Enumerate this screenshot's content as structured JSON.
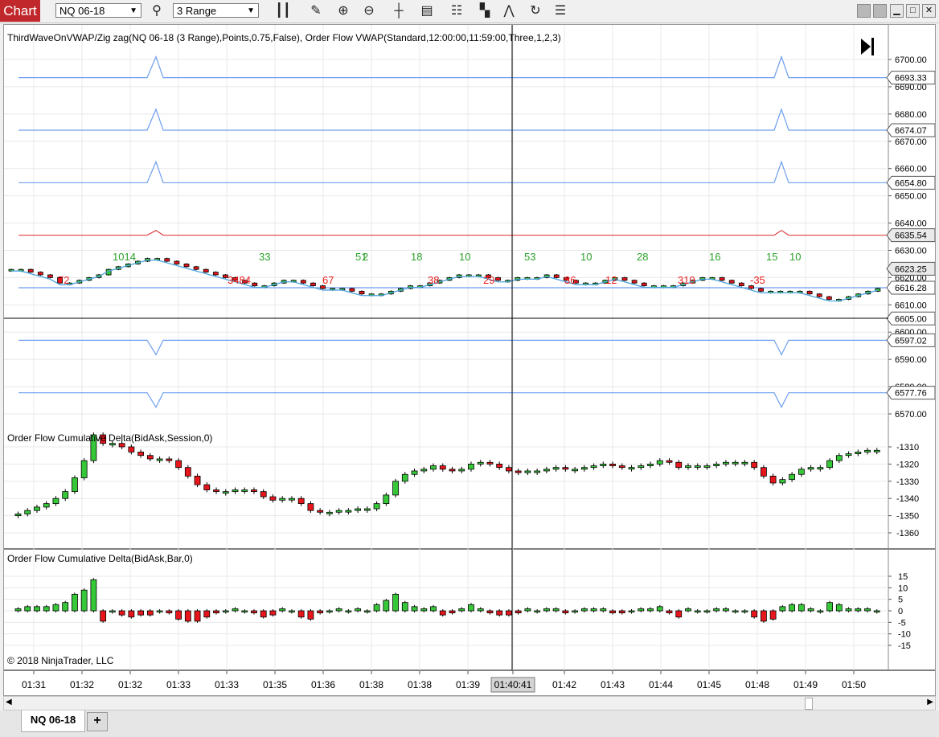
{
  "window": {
    "title": "Chart",
    "instrument": "NQ 06-18",
    "bar_type": "3 Range",
    "toolbar_icons": [
      "bar-type-icon",
      "draw-icon",
      "zoom-in-icon",
      "zoom-out-icon",
      "crosshair-icon",
      "data-box-icon",
      "properties-icon",
      "indicators-icon",
      "strategies-icon",
      "refresh-icon",
      "list-icon"
    ]
  },
  "colors": {
    "up": "#37c83a",
    "down": "#e8161c",
    "vwap_band": "#6d9ef0",
    "zigzag": "#e04040",
    "crosshair": "#000000",
    "grid": "#e8e8e8",
    "label_up": "#2aa12a",
    "label_down": "#e82020"
  },
  "panels": {
    "price": {
      "label": "ThirdWaveOnVWAP/Zig zag(NQ 06-18 (3 Range),Points,0.75,False), Order Flow VWAP(Standard,12:00:00,11:59:00,Three,1,2,3)",
      "y_ticks": [
        "6700.00",
        "6690.00",
        "6680.00",
        "6670.00",
        "6660.00",
        "6650.00",
        "6640.00",
        "6630.00",
        "6620.00",
        "6610.00",
        "6600.00",
        "6590.00",
        "6580.00",
        "6570.00"
      ],
      "price_tags": [
        {
          "value": "6693.33",
          "style": "band"
        },
        {
          "value": "6674.07",
          "style": "band"
        },
        {
          "value": "6654.80",
          "style": "band"
        },
        {
          "value": "6635.54",
          "style": "zigzag"
        },
        {
          "value": "6623.25",
          "style": "last"
        },
        {
          "value": "6616.28",
          "style": "band"
        },
        {
          "value": "6605.00",
          "style": "cross"
        },
        {
          "value": "6597.02",
          "style": "band"
        },
        {
          "value": "6577.76",
          "style": "band"
        }
      ],
      "wave_labels": [
        {
          "text": "72",
          "kind": "down"
        },
        {
          "text": "1014",
          "kind": "up"
        },
        {
          "text": "3484",
          "kind": "down"
        },
        {
          "text": "33",
          "kind": "up"
        },
        {
          "text": "67",
          "kind": "down"
        },
        {
          "text": "51",
          "kind": "up"
        },
        {
          "text": "2",
          "kind": "up"
        },
        {
          "text": "18",
          "kind": "up"
        },
        {
          "text": "38",
          "kind": "down"
        },
        {
          "text": "10",
          "kind": "up"
        },
        {
          "text": "29",
          "kind": "down"
        },
        {
          "text": "53",
          "kind": "up"
        },
        {
          "text": "36",
          "kind": "down"
        },
        {
          "text": "10",
          "kind": "up"
        },
        {
          "text": "12",
          "kind": "down"
        },
        {
          "text": "28",
          "kind": "up"
        },
        {
          "text": "319",
          "kind": "down"
        },
        {
          "text": "16",
          "kind": "up"
        },
        {
          "text": "-35",
          "kind": "down"
        },
        {
          "text": "15",
          "kind": "up"
        },
        {
          "text": "10",
          "kind": "up"
        }
      ]
    },
    "cum_delta_session": {
      "label": "Order Flow Cumulative Delta(BidAsk,Session,0)",
      "y_ticks": [
        "-1310",
        "-1320",
        "-1330",
        "-1340",
        "-1350",
        "-1360"
      ]
    },
    "cum_delta_bar": {
      "label": "Order Flow Cumulative Delta(BidAsk,Bar,0)",
      "y_ticks": [
        "15",
        "10",
        "5",
        "0",
        "-5",
        "-10",
        "-15"
      ]
    }
  },
  "time_axis": {
    "labels": [
      "01:31",
      "01:32",
      "01:32",
      "01:33",
      "01:33",
      "01:35",
      "01:36",
      "01:38",
      "01:38",
      "01:39",
      "01:40:41",
      "01:42",
      "01:43",
      "01:44",
      "01:45",
      "01:48",
      "01:49",
      "01:50"
    ],
    "crosshair_time": "01:40:41"
  },
  "copyright": "© 2018 NinjaTrader, LLC",
  "tabs": [
    {
      "label": "NQ 06-18",
      "active": true
    }
  ],
  "add_tab_label": "+"
}
